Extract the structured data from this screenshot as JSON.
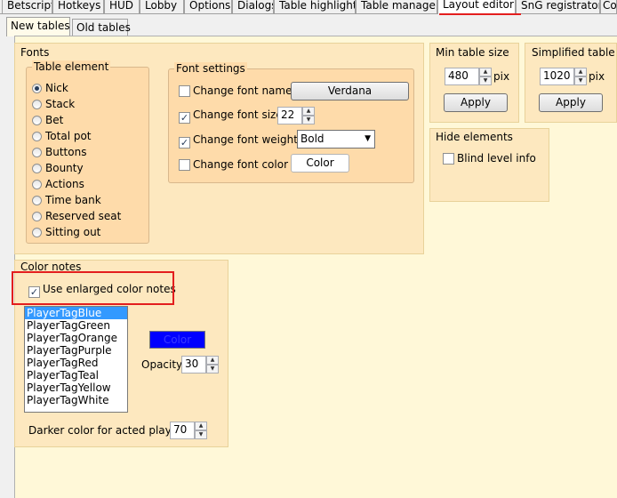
{
  "top_tabs": [
    "Betscript",
    "Hotkeys",
    "HUD",
    "Lobby",
    "Options",
    "Dialogs",
    "Table highlight",
    "Table manager",
    "Layout editor",
    "SnG registrator",
    "Co"
  ],
  "sub_tabs": [
    "New tables",
    "Old tables"
  ],
  "fonts": {
    "title": "Fonts",
    "table_element": {
      "title": "Table element",
      "options": [
        "Nick",
        "Stack",
        "Bet",
        "Total pot",
        "Buttons",
        "Bounty",
        "Actions",
        "Time bank",
        "Reserved seat",
        "Sitting out"
      ],
      "selected": "Nick"
    },
    "font_settings": {
      "title": "Font settings",
      "change_font_name": {
        "label": "Change font name",
        "checked": false,
        "button": "Verdana"
      },
      "change_font_size": {
        "label": "Change font size",
        "checked": true,
        "value": "22"
      },
      "change_font_weight": {
        "label": "Change font weight",
        "checked": true,
        "value": "Bold"
      },
      "change_font_color": {
        "label": "Change font color",
        "checked": false,
        "button": "Color"
      }
    }
  },
  "min_table_size": {
    "title": "Min table size",
    "value": "480",
    "unit": "pix",
    "apply": "Apply"
  },
  "simplified_table_size": {
    "title": "Simplified table size",
    "value": "1020",
    "unit": "pix",
    "apply": "Apply"
  },
  "hide_elements": {
    "title": "Hide elements",
    "blind_level_info": {
      "label": "Blind level info",
      "checked": false
    }
  },
  "color_notes": {
    "title": "Color notes",
    "use_enlarged": {
      "label": "Use enlarged color notes",
      "checked": true
    },
    "tags": [
      "PlayerTagBlue",
      "PlayerTagGreen",
      "PlayerTagOrange",
      "PlayerTagPurple",
      "PlayerTagRed",
      "PlayerTagTeal",
      "PlayerTagYellow",
      "PlayerTagWhite"
    ],
    "selected_tag": "PlayerTagBlue",
    "color_button": "Color",
    "color_swatch": "#0000ff",
    "opacity_label": "Opacity",
    "opacity_value": "30",
    "darker_label": "Darker color for acted player",
    "darker_value": "70"
  },
  "colors": {
    "highlight_red": "#e31e1e",
    "panel": "#fde8bf",
    "content": "#fff8d8"
  }
}
